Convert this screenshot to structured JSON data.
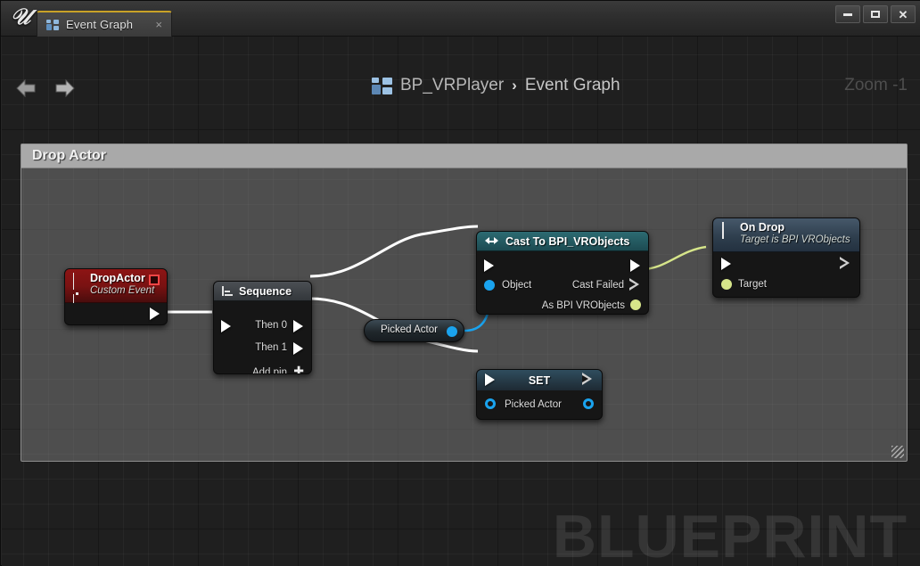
{
  "window": {
    "logo": "unreal-engine-logo",
    "tab": {
      "label": "Event Graph",
      "close": "×",
      "icon": "blueprint-icon"
    },
    "controls": {
      "minimize": "minimize-icon",
      "maximize": "maximize-icon",
      "close": "close-icon"
    }
  },
  "toolbar": {
    "back": "back-arrow-icon",
    "forward": "forward-arrow-icon",
    "breadcrumb": {
      "icon": "blueprint-icon",
      "root": "BP_VRPlayer",
      "separator": "›",
      "current": "Event Graph"
    },
    "zoom_label": "Zoom -1"
  },
  "canvas": {
    "watermark": "BLUEPRINT",
    "comment": {
      "title": "Drop Actor"
    }
  },
  "nodes": {
    "drop_actor": {
      "title": "DropActor",
      "subtitle": "Custom Event",
      "header_color": "#8d1414",
      "delegate_pin": "delegate-output-pin"
    },
    "sequence": {
      "title": "Sequence",
      "then0": "Then 0",
      "then1": "Then 1",
      "add_pin": "Add pin",
      "add_pin_glyph": "✚",
      "header_color": "#4b4f54"
    },
    "cast": {
      "title": "Cast To BPI_VRObjects",
      "input_object": "Object",
      "cast_failed": "Cast Failed",
      "as_object": "As BPI VRObjects",
      "header_color": "#2c6b72"
    },
    "on_drop": {
      "title": "On Drop",
      "subtitle": "Target is BPI VRObjects",
      "target": "Target",
      "header_color": "#46586a"
    },
    "set_node": {
      "title": "SET",
      "variable": "Picked Actor",
      "header_color": "#2f4d5e"
    },
    "getter": {
      "label": "Picked Actor"
    }
  },
  "wire_colors": {
    "exec": "#ffffff",
    "object_ref": "#1aa3ee",
    "interface_ref": "#d6e58a"
  }
}
